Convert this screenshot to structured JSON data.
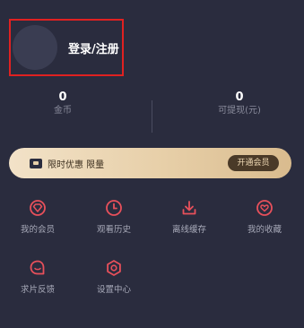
{
  "profile": {
    "login_label": "登录/注册"
  },
  "stats": [
    {
      "value": "0",
      "label": "金币"
    },
    {
      "value": "0",
      "label": "可提现(元)"
    }
  ],
  "vip_banner": {
    "text": "限时优惠 限量",
    "button_label": "开通会员",
    "icon": "crown-icon"
  },
  "menu": [
    {
      "label": "我的会员",
      "icon": "vip-gem-icon"
    },
    {
      "label": "观看历史",
      "icon": "clock-icon"
    },
    {
      "label": "离线缓存",
      "icon": "download-icon"
    },
    {
      "label": "我的收藏",
      "icon": "heart-icon"
    },
    {
      "label": "求片反馈",
      "icon": "chat-icon"
    },
    {
      "label": "设置中心",
      "icon": "gear-icon"
    }
  ],
  "colors": {
    "background": "#2a2c3e",
    "accent_red": "#e8505b",
    "highlight_border": "#e02121",
    "banner_gold": "#e7cfa8"
  }
}
